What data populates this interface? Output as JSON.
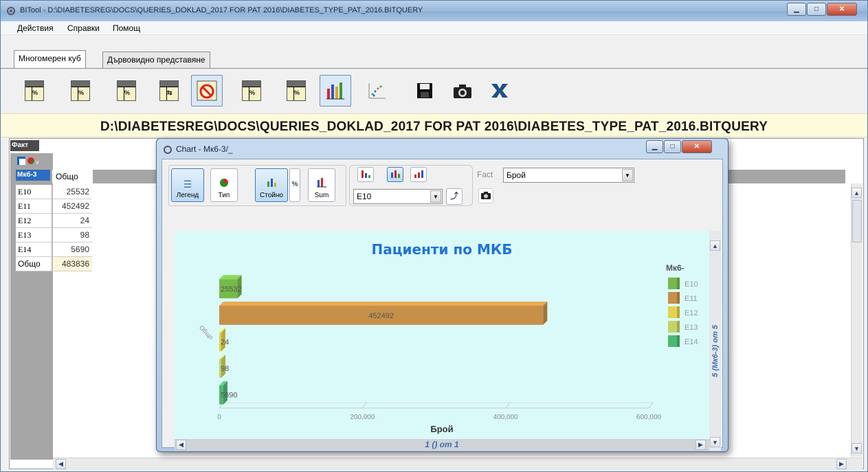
{
  "window": {
    "title": "BITool - D:\\DIABETESREG\\DOCS\\QUERIES_DOKLAD_2017 FOR PAT 2016\\DIABETES_TYPE_PAT_2016.BITQUERY"
  },
  "menu": [
    "Действия",
    "Справки",
    "Помощ"
  ],
  "tabs": [
    {
      "label": "Многомерен куб",
      "active": true
    },
    {
      "label": "Дървовидно представяне",
      "active": false
    }
  ],
  "toolbar": {
    "icons": [
      "grid-percent-icon",
      "grid-percent-col-icon",
      "grid-percent-row-icon",
      "grid-arrow-icon",
      "no-filter-icon",
      "grid-sum-icon",
      "grid-sum-alt-icon",
      "bar-chart-icon",
      "scatter-chart-icon",
      "save-icon",
      "camera-icon",
      "excel-icon"
    ]
  },
  "path": "D:\\DIABETESREG\\DOCS\\QUERIES_DOKLAD_2017 FOR PAT 2016\\DIABETES_TYPE_PAT_2016.BITQUERY",
  "pivot": {
    "fact_label": "Факт",
    "dim_label": "Мкб-3",
    "column_header": "Общо",
    "rows": [
      {
        "label": "E10",
        "value": "25532"
      },
      {
        "label": "E11",
        "value": "452492"
      },
      {
        "label": "E12",
        "value": "24"
      },
      {
        "label": "E13",
        "value": "98"
      },
      {
        "label": "E14",
        "value": "5690"
      },
      {
        "label": "Общо",
        "value": "483836"
      }
    ]
  },
  "chart_window": {
    "title": "Chart - Мк6-3/_",
    "buttons": {
      "legend": "Легенд",
      "type": "Тип",
      "values": "Стойно",
      "percent": "%",
      "sum": "Sum"
    },
    "series_combo": "E10",
    "fact_label": "Fact",
    "fact_combo": "Брой",
    "vertical_caption": "5 (Мк6-3) от 5",
    "page_caption": "1 () от 1"
  },
  "chart_data": {
    "type": "bar",
    "orientation": "horizontal",
    "title": "Пациенти по МКБ",
    "xlabel": "Брой",
    "ylabel": "Общо",
    "xlim": [
      0,
      600000
    ],
    "xticks": [
      "0",
      "200,000",
      "400,000",
      "600,000"
    ],
    "legend_title": "Мк6-",
    "legend_position": "right",
    "categories": [
      "E10",
      "E11",
      "E12",
      "E13",
      "E14"
    ],
    "values": [
      25532,
      452492,
      24,
      98,
      5690
    ],
    "value_labels": [
      "25532",
      "452492",
      "24",
      "98",
      "5690"
    ],
    "colors": [
      "#77b94a",
      "#c69048",
      "#e3d24b",
      "#c6d364",
      "#4fb874"
    ]
  }
}
